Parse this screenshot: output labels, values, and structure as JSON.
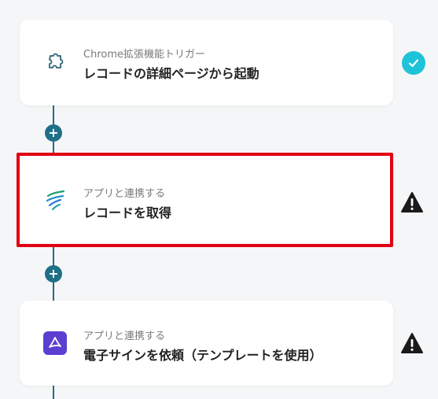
{
  "flow": {
    "steps": [
      {
        "subtitle": "Chrome拡張機能トリガー",
        "title": "レコードの詳細ページから起動",
        "icon": "puzzle-icon",
        "status": "check-icon"
      },
      {
        "subtitle": "アプリと連携する",
        "title": "レコードを取得",
        "icon": "app-logo-icon",
        "status": "warning-icon"
      },
      {
        "subtitle": "アプリと連携する",
        "title": "電子サインを依頼（テンプレートを使用）",
        "icon": "acrobat-sign-icon",
        "status": "warning-icon"
      }
    ],
    "add_step_label": "+"
  },
  "colors": {
    "accent": "#1f6f87",
    "selection": "#e00012",
    "check": "#1ec3d8",
    "warning": "#1a1a1a",
    "sign_icon_bg": "#5b3fd0"
  }
}
